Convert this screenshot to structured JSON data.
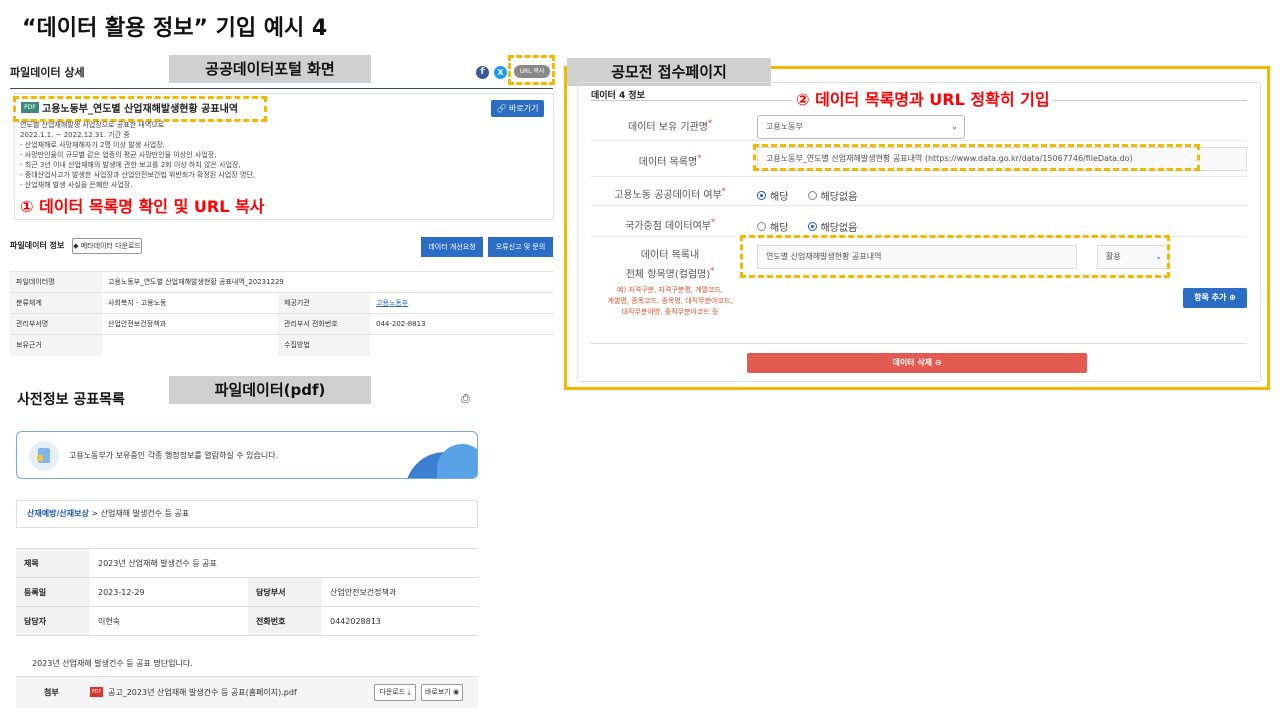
{
  "slide_title": "“데이터 활용 정보” 기입 예시 4",
  "left": {
    "panel_title": "파일데이터 상세",
    "tag_portal": "공공데이터포털 화면",
    "url_copy_label": "URL 복사",
    "pdf_badge": "PDF",
    "dataset_title": "고용노동부_연도별 산업재해발생현황 공표내역",
    "goto_label": "바로가기",
    "desc_lines": [
      "연도별 산업재해발생 사업장으로 공표한 내역으로",
      "2022.1.1. ~ 2022.12.31. 기간 중",
      "- 산업재해로 사망재해자가 2명 이상 발생 사업장,",
      "- 사망만인율이 규모별 같은 업종의 평균 사망만인율 이상인 사업장,",
      "- 최근 3년 이내 산업재해의 발생에 관한 보고를 2회 이상 하지 않은 사업장,",
      "- 중대산업사고가 발생한 사업장과 산업안전보건법 위반죄가 확정된 사업장 명단,",
      "- 산업재해 발생 사실을 은폐한 사업장."
    ],
    "note1": "① 데이터 목록명 확인 및 URL 복사",
    "file_info_label": "파일데이터 정보",
    "meta_download_label": "메타데이터 다운로드",
    "improve_label": "데이터 개선요청",
    "report_label": "오류신고 및 문의",
    "table": [
      {
        "k1": "파일데이터명",
        "v1": "고용노동부_연도별 산업재해발생현황 공표내역_20231229",
        "k2": "",
        "v2": ""
      },
      {
        "k1": "분류체계",
        "v1": "사회복지 - 고용노동",
        "k2": "제공기관",
        "v2": "고용노동부"
      },
      {
        "k1": "관리부서명",
        "v1": "산업안전보건정책과",
        "k2": "관리부서 전화번호",
        "v2": "044-202-8813"
      },
      {
        "k1": "보유근거",
        "v1": "",
        "k2": "수집방법",
        "v2": ""
      }
    ]
  },
  "lower": {
    "heading": "사전정보 공표목록",
    "tag_pdf": "파일데이터(pdf)",
    "banner_text": "고용노동부가 보유중인 각종 행정정보를 열람하실 수 있습니다.",
    "breadcrumb_link": "산재예방/산재보상",
    "breadcrumb_rest": " > 산업재해 발생건수 등 공표",
    "rows": [
      {
        "k1": "제목",
        "v1": "2023년 산업재해 발생건수 등 공표",
        "k2": "",
        "v2": ""
      },
      {
        "k1": "등록일",
        "v1": "2023-12-29",
        "k2": "담당부서",
        "v2": "산업안전보건정책과"
      },
      {
        "k1": "담당자",
        "v1": "이현숙",
        "k2": "전화번호",
        "v2": "0442028813"
      }
    ],
    "body_text": "2023년 산업재해 발생건수 등 공표 명단입니다.",
    "attach_label": "첨부",
    "attach_pdf": "PDF",
    "attach_file": "공고_2023년 산업재해 발생건수 등 공표(홈페이지).pdf",
    "download_label": "다운로드",
    "preview_label": "바로보기"
  },
  "right": {
    "tag_contest": "공모전 접수페이지",
    "section_title": "데이터 4 정보",
    "note2": "② 데이터 목록명과 URL 정확히 기입",
    "label_org": "데이터 보유 기관명",
    "org_value": "고용노동부",
    "label_name": "데이터 목록명",
    "name_value": "고용노동부_연도별 산업재해발생현황 공표내역 (https://www.data.go.kr/data/15067746/fileData.do)",
    "label_public": "고용노동 공공데이터 여부",
    "label_national": "국가중점 데이터여부",
    "opt_yes": "해당",
    "opt_no": "해당없음",
    "label_items_1": "데이터 목록내",
    "label_items_2": "전체 항목명(컬럼명)",
    "items_value": "연도별 산업재해발생현황 공표내역",
    "use_value": "활용",
    "example_lines": [
      "예) 자격구분, 자격구분명, 계열코드,",
      "계열명, 종목코드, 종목명, 대직무분야코드,",
      "대직무분야명, 중직무분야코드 등"
    ],
    "add_item_label": "항목 추가",
    "delete_label": "데이터 삭제",
    "colors": {
      "yellow": "#f5b700",
      "red": "#ff0000",
      "blue": "#2b6cc4",
      "delete": "#e25a52"
    }
  }
}
